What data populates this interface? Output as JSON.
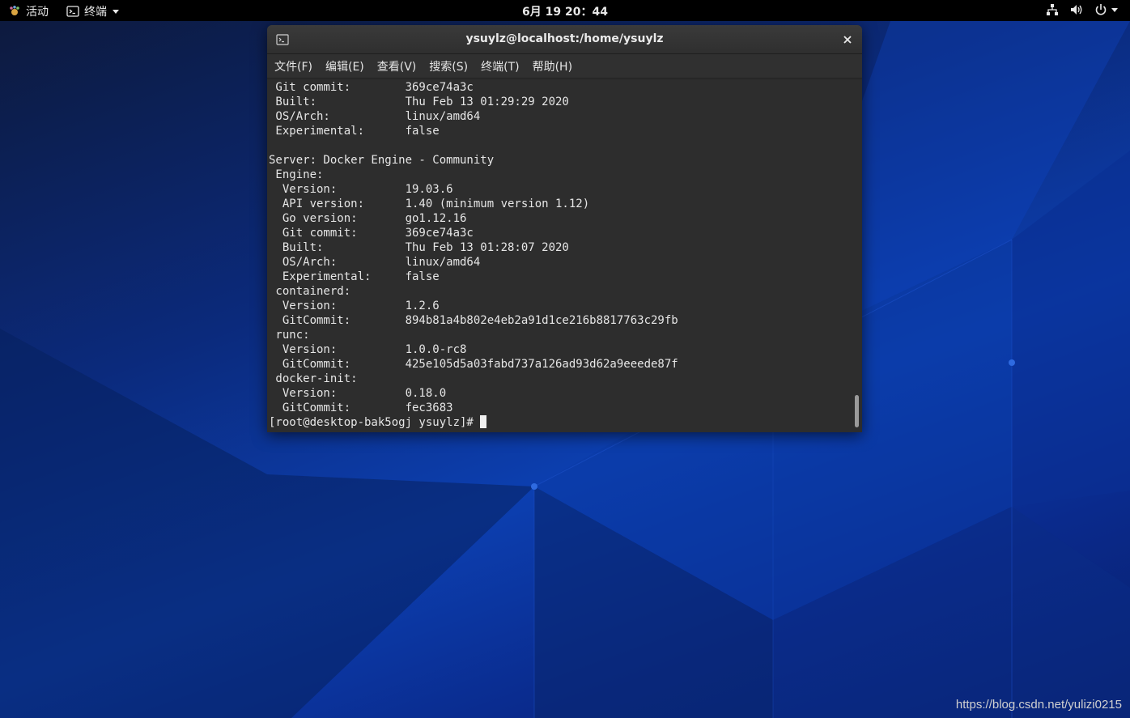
{
  "topbar": {
    "activities_label": "活动",
    "app_menu_label": "终端",
    "clock": "6月 19 20：44",
    "tray_icons": [
      "network-icon",
      "volume-icon",
      "power-icon"
    ]
  },
  "window": {
    "title": "ysuylz@localhost:/home/ysuylz",
    "menu": [
      "文件(F)",
      "编辑(E)",
      "查看(V)",
      "搜索(S)",
      "终端(T)",
      "帮助(H)"
    ]
  },
  "terminal": {
    "lines": [
      " Git commit:        369ce74a3c",
      " Built:             Thu Feb 13 01:29:29 2020",
      " OS/Arch:           linux/amd64",
      " Experimental:      false",
      "",
      "Server: Docker Engine - Community",
      " Engine:",
      "  Version:          19.03.6",
      "  API version:      1.40 (minimum version 1.12)",
      "  Go version:       go1.12.16",
      "  Git commit:       369ce74a3c",
      "  Built:            Thu Feb 13 01:28:07 2020",
      "  OS/Arch:          linux/amd64",
      "  Experimental:     false",
      " containerd:",
      "  Version:          1.2.6",
      "  GitCommit:        894b81a4b802e4eb2a91d1ce216b8817763c29fb",
      " runc:",
      "  Version:          1.0.0-rc8",
      "  GitCommit:        425e105d5a03fabd737a126ad93d62a9eeede87f",
      " docker-init:",
      "  Version:          0.18.0",
      "  GitCommit:        fec3683"
    ],
    "prompt": "[root@desktop-bak5ogj ysuylz]# "
  },
  "watermark": "https://blog.csdn.net/yulizi0215",
  "colors": {
    "topbar_bg": "#000000",
    "terminal_bg": "#2d2d2d",
    "terminal_fg": "#e6e6e6",
    "desktop_accent": "#0c3fb0"
  }
}
